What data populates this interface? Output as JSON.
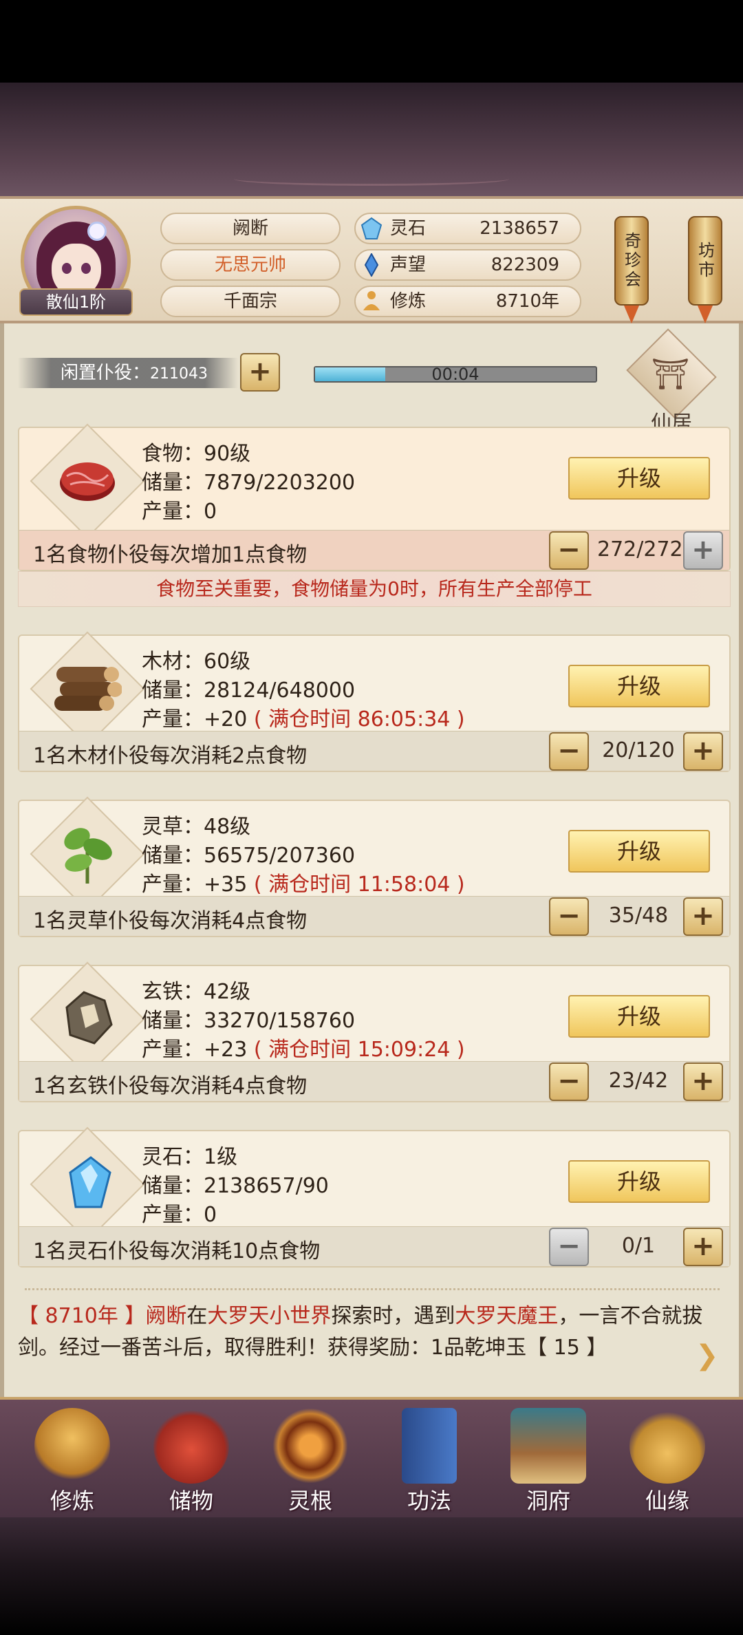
{
  "header": {
    "player_name": "阙断",
    "title": "无思元帅",
    "sect": "千面宗",
    "rank": "散仙1阶",
    "stats": [
      {
        "icon": "spirit-stone-icon",
        "label": "灵石",
        "value": "2138657"
      },
      {
        "icon": "reputation-icon",
        "label": "声望",
        "value": "822309"
      },
      {
        "icon": "cultivation-icon",
        "label": "修炼",
        "value": "8710年"
      }
    ],
    "side_buttons": [
      "奇珍会",
      "坊市"
    ]
  },
  "idle": {
    "label": "闲置仆役：",
    "count": "211043",
    "add": "+",
    "progress_text": "00:04",
    "progress_fraction": 0.25
  },
  "xianju": {
    "icon": "pavilion-icon",
    "label": "仙居"
  },
  "resources": [
    {
      "icon": "meat-icon",
      "name_line": "食物：90级",
      "storage_line": "储量：7879/2203200",
      "output_label": "产量：",
      "output_value": "0",
      "full_time": "",
      "upgrade": "升级",
      "desc": "1名食物仆役每次增加1点食物",
      "count": "272/272",
      "minus": "−",
      "plus": "+"
    },
    {
      "icon": "wood-logs-icon",
      "name_line": "木材：60级",
      "storage_line": "储量：28124/648000",
      "output_label": "产量：",
      "output_value": "+20",
      "full_time": "( 满仓时间 86:05:34 )",
      "upgrade": "升级",
      "desc": "1名木材仆役每次消耗2点食物",
      "count": "20/120",
      "minus": "−",
      "plus": "+"
    },
    {
      "icon": "herb-icon",
      "name_line": "灵草：48级",
      "storage_line": "储量：56575/207360",
      "output_label": "产量：",
      "output_value": "+35",
      "full_time": "( 满仓时间 11:58:04 )",
      "upgrade": "升级",
      "desc": "1名灵草仆役每次消耗4点食物",
      "count": "35/48",
      "minus": "−",
      "plus": "+"
    },
    {
      "icon": "iron-ore-icon",
      "name_line": "玄铁：42级",
      "storage_line": "储量：33270/158760",
      "output_label": "产量：",
      "output_value": "+23",
      "full_time": "( 满仓时间 15:09:24 )",
      "upgrade": "升级",
      "desc": "1名玄铁仆役每次消耗4点食物",
      "count": "23/42",
      "minus": "−",
      "plus": "+"
    },
    {
      "icon": "crystal-icon",
      "name_line": "灵石：1级",
      "storage_line": "储量：2138657/90",
      "output_label": "产量：",
      "output_value": "0",
      "full_time": "",
      "upgrade": "升级",
      "desc": "1名灵石仆役每次消耗10点食物",
      "count": "0/1",
      "minus": "−",
      "plus": "+"
    }
  ],
  "warning": "食物至关重要，食物储量为0时，所有生产全部停工",
  "log": {
    "year": "【 8710年 】",
    "name": "阙断",
    "t1": "在",
    "place": "大罗天小世界",
    "t2": "探索时，遇到",
    "enemy": "大罗天魔王",
    "t3": "，一言不合就拔剑。经过一番苦斗后，取得胜利！获得奖励：1品乾坤玉【 15 】"
  },
  "nav": [
    {
      "icon": "meditation-icon",
      "label": "修炼"
    },
    {
      "icon": "bag-icon",
      "label": "储物"
    },
    {
      "icon": "spirit-root-icon",
      "label": "灵根"
    },
    {
      "icon": "book-icon",
      "label": "功法"
    },
    {
      "icon": "cave-mansion-icon",
      "label": "洞府"
    },
    {
      "icon": "gourd-icon",
      "label": "仙缘"
    }
  ],
  "colors": {
    "accent_red": "#b8281c",
    "title_orange": "#d2602a",
    "gold": "#f0c65c"
  }
}
